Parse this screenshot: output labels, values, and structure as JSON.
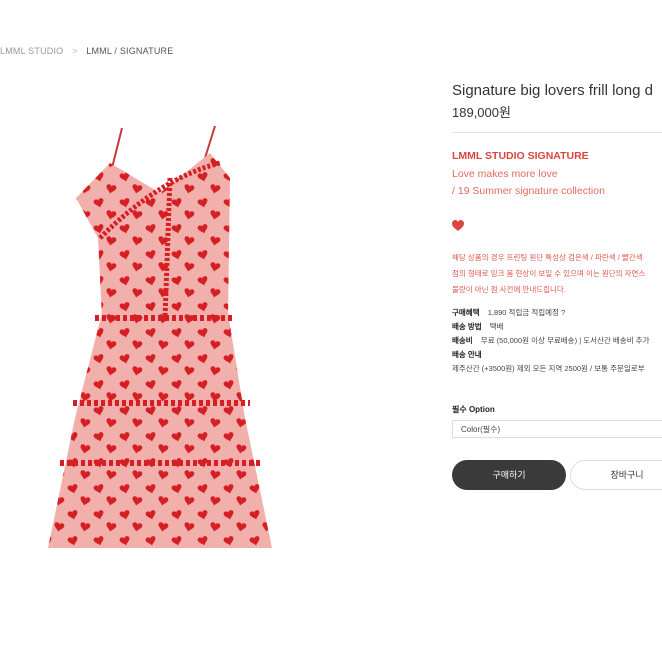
{
  "breadcrumb": {
    "home": "LMML STUDIO",
    "separator": ">",
    "current": "LMML / SIGNATURE"
  },
  "product": {
    "title": "Signature big lovers frill long d",
    "price": "189,000원",
    "brand": "LMML STUDIO SIGNATURE",
    "desc_line1": "Love makes more love",
    "desc_line2": "/ 19 Summer signature collection",
    "wishlist_icon": "heart-icon",
    "notice_lines": [
      "해당 상품의 경우 프린팅 원단 특성상 검은색 / 파란색 / 빨간색",
      "점의 형태로 잉크 뭄 현상이 보일 수 있으며 이는 원단의 자연스",
      "불량이 아닌 점 사전에 안내드립니다."
    ]
  },
  "specs": {
    "points_label": "구매혜택",
    "points_value": "1,890 적립금 적립예정 ?",
    "method_label": "배송 방법",
    "method_value": "택배",
    "fee_label": "배송비",
    "fee_value_1": "무료 (50,000원 이상 무료배송)",
    "fee_value_2": "| 도서산간 배송비 추가",
    "guide_label": "배송 안내",
    "guide_value": "제주산간 (+3500원) 제외 모든 지역 2500원 / 보통 주문일로부"
  },
  "option": {
    "label": "필수 Option",
    "selected": "Color(필수)"
  },
  "buttons": {
    "buy": "구매하기",
    "cart": "장바구니"
  },
  "colors": {
    "accent": "#d9463f",
    "dress_base": "#f2b0ac",
    "heart": "#d51f25",
    "button_dark": "#3a3a3a"
  }
}
